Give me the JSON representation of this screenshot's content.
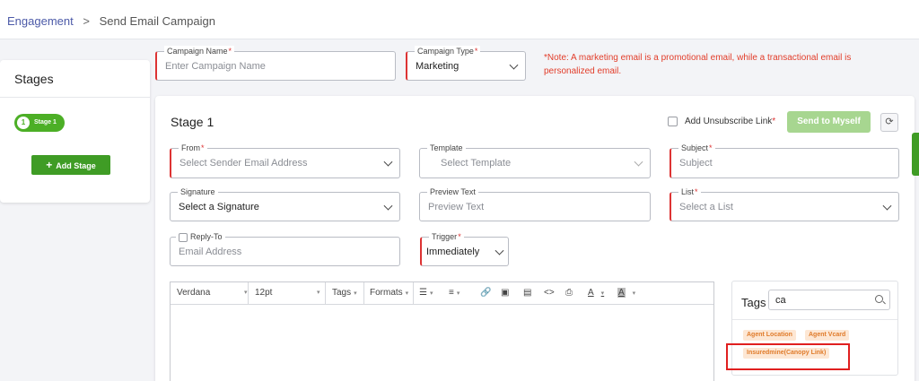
{
  "breadcrumb": {
    "root": "Engagement",
    "separator": ">",
    "current": "Send Email Campaign"
  },
  "campaign": {
    "name_label": "Campaign Name",
    "name_placeholder": "Enter Campaign Name",
    "type_label": "Campaign Type",
    "type_value": "Marketing",
    "note": "*Note: A marketing email is a promotional email, while a transactional email is personalized email."
  },
  "required_marker": "*",
  "stages_panel": {
    "title": "Stages",
    "stage_number": "1",
    "stage_label": "Stage 1",
    "add_button": "Add Stage",
    "add_icon": "+"
  },
  "stage": {
    "title": "Stage 1",
    "unsubscribe_label": "Add Unsubscribe Link",
    "send_button": "Send to Myself",
    "refresh_icon": "⟳",
    "fields": {
      "from": {
        "label": "From",
        "placeholder": "Select Sender Email Address"
      },
      "template": {
        "label": "Template",
        "placeholder": "Select Template"
      },
      "subject": {
        "label": "Subject",
        "placeholder": "Subject"
      },
      "signature": {
        "label": "Signature",
        "value": "Select a Signature"
      },
      "preview_text": {
        "label": "Preview Text",
        "placeholder": "Preview Text"
      },
      "list": {
        "label": "List",
        "placeholder": "Select a List"
      },
      "reply_to": {
        "label": "Reply-To",
        "placeholder": "Email Address"
      },
      "trigger": {
        "label": "Trigger",
        "value": "Immediately"
      }
    }
  },
  "editor_toolbar": {
    "font": "Verdana",
    "size": "12pt",
    "tags": "Tags",
    "formats": "Formats",
    "dropdown_glyph": "▾",
    "icons": {
      "bullet_list": "☰",
      "numbered_list": "≡",
      "link": "🔗",
      "image": "▣",
      "media": "▤",
      "code": "<>",
      "print": "⎙",
      "text_color": "A",
      "bg_color": "A"
    }
  },
  "tags_panel": {
    "title": "Tags",
    "search_value": "ca",
    "chips": [
      "Agent Location",
      "Agent Vcard",
      "Insuredmine(Canopy Link)"
    ]
  },
  "colors": {
    "primary_green": "#4caf26",
    "required_red": "#d33333",
    "note_red": "#e23d2a",
    "chip_bg": "#fde7d4",
    "chip_text": "#e07b2a"
  }
}
